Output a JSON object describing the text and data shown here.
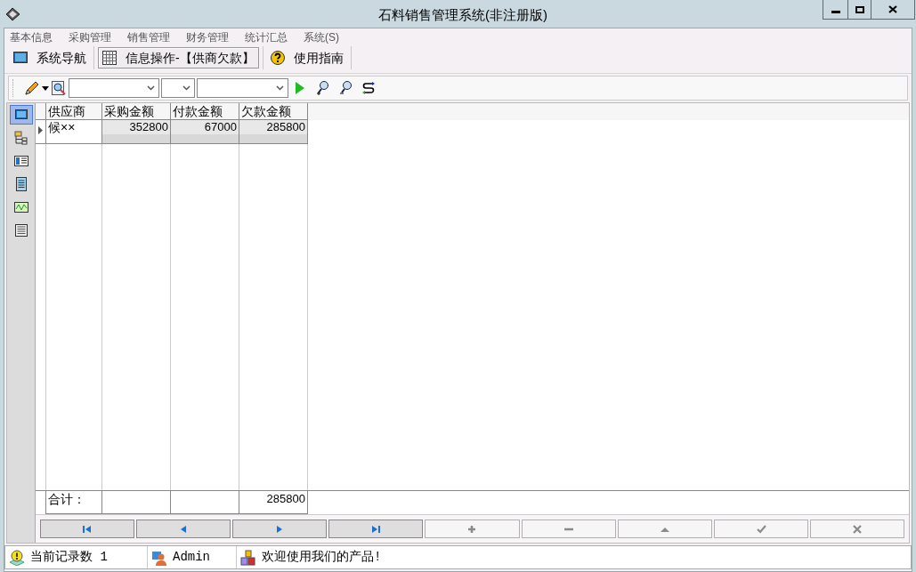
{
  "window": {
    "title": "石料销售管理系统(非注册版)"
  },
  "menu": [
    "基本信息",
    "采购管理",
    "销售管理",
    "财务管理",
    "统计汇总",
    "系统(S)"
  ],
  "tabs": [
    {
      "kind": "nav",
      "label": "系统导航",
      "selected": false
    },
    {
      "kind": "grid",
      "label": "信息操作-【供商欠款】",
      "selected": true
    },
    {
      "kind": "help",
      "label": "使用指南",
      "selected": false
    }
  ],
  "side_tools": [
    {
      "kind": "monitor",
      "selected": true
    },
    {
      "kind": "tree",
      "selected": false
    },
    {
      "kind": "card",
      "selected": false
    },
    {
      "kind": "doc",
      "selected": false
    },
    {
      "kind": "chart",
      "selected": false
    },
    {
      "kind": "printer",
      "selected": false
    }
  ],
  "table": {
    "columns": [
      "供应商",
      "采购金额",
      "付款金额",
      "欠款金额"
    ],
    "rows": [
      {
        "selected": true,
        "cells": [
          "候××",
          "352800",
          "67000",
          "285800"
        ]
      }
    ],
    "total_label": "合计：",
    "total_value": "285800"
  },
  "nav_buttons": [
    {
      "kind": "first",
      "disabled": false
    },
    {
      "kind": "prev",
      "disabled": false
    },
    {
      "kind": "next",
      "disabled": false
    },
    {
      "kind": "last",
      "disabled": false
    },
    {
      "kind": "add",
      "disabled": true
    },
    {
      "kind": "delete",
      "disabled": true
    },
    {
      "kind": "edit",
      "disabled": true
    },
    {
      "kind": "save",
      "disabled": true
    },
    {
      "kind": "cancel",
      "disabled": true
    }
  ],
  "status_bar": [
    {
      "kind": "tip",
      "text": "当前记录数 1"
    },
    {
      "kind": "user",
      "text": "Admin"
    },
    {
      "kind": "product",
      "text": "欢迎使用我们的产品!"
    }
  ]
}
